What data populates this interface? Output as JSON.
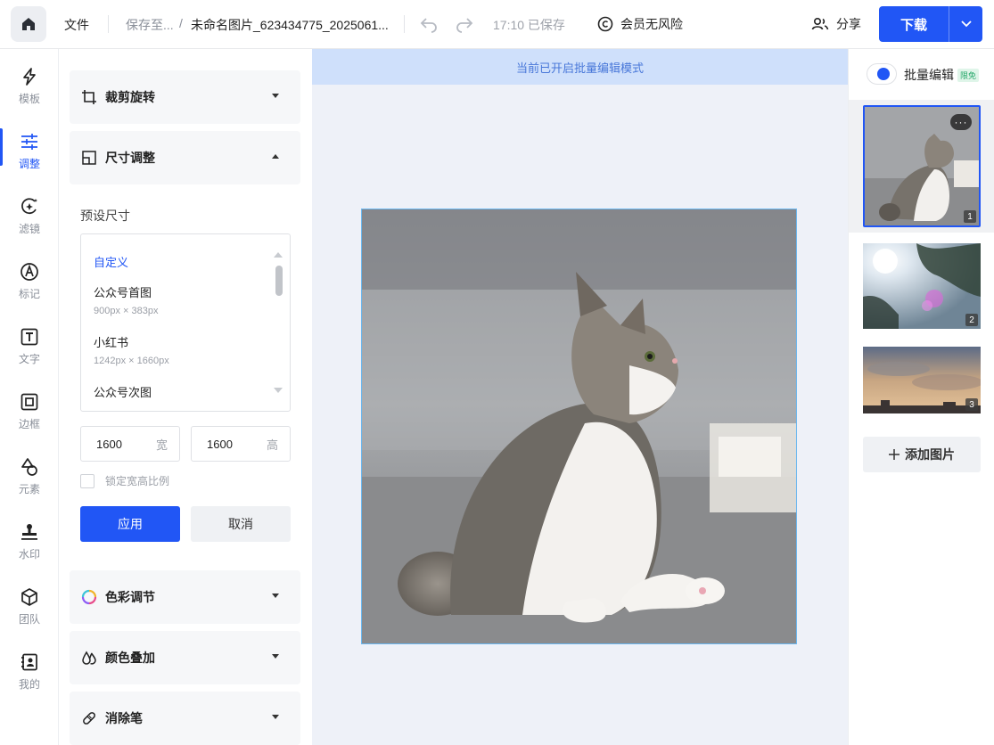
{
  "topbar": {
    "file_menu": "文件",
    "save_to": "保存至...",
    "separator": "/",
    "file_name": "未命名图片_623434775_2025061...",
    "saved_status": "17:10 已保存",
    "vip_label": "会员无风险",
    "share_label": "分享",
    "download_label": "下载"
  },
  "nav": {
    "items": [
      {
        "label": "模板",
        "icon": "lightning-icon"
      },
      {
        "label": "调整",
        "icon": "sliders-icon",
        "active": true
      },
      {
        "label": "滤镜",
        "icon": "filter-sparkle-icon"
      },
      {
        "label": "标记",
        "icon": "pen-nib-icon"
      },
      {
        "label": "文字",
        "icon": "text-T-icon"
      },
      {
        "label": "边框",
        "icon": "frame-icon"
      },
      {
        "label": "元素",
        "icon": "shapes-icon"
      },
      {
        "label": "水印",
        "icon": "stamp-icon"
      },
      {
        "label": "团队",
        "icon": "cube-icon"
      },
      {
        "label": "我的",
        "icon": "user-book-icon"
      }
    ]
  },
  "panel": {
    "crop_rotate": "裁剪旋转",
    "resize": "尺寸调整",
    "preset_label": "预设尺寸",
    "presets": [
      {
        "name": "自定义",
        "size": ""
      },
      {
        "name": "公众号首图",
        "size": "900px × 383px"
      },
      {
        "name": "小红书",
        "size": "1242px × 1660px"
      },
      {
        "name": "公众号次图",
        "size": ""
      }
    ],
    "width_value": "1600",
    "width_unit": "宽",
    "height_value": "1600",
    "height_unit": "高",
    "lock_ratio": "锁定宽高比例",
    "apply": "应用",
    "cancel": "取消",
    "color_adjust": "色彩调节",
    "color_overlay": "颜色叠加",
    "eraser": "消除笔"
  },
  "canvas": {
    "banner": "当前已开启批量编辑模式"
  },
  "right": {
    "batch_edit": "批量编辑",
    "badge": "限免",
    "thumbs": [
      {
        "num": "1",
        "more": "···"
      },
      {
        "num": "2"
      },
      {
        "num": "3"
      }
    ],
    "add_image": "添加图片"
  },
  "colors": {
    "accent": "#2156f5",
    "banner_bg": "#cfe0fb",
    "canvas_bg": "#eef1f8"
  }
}
